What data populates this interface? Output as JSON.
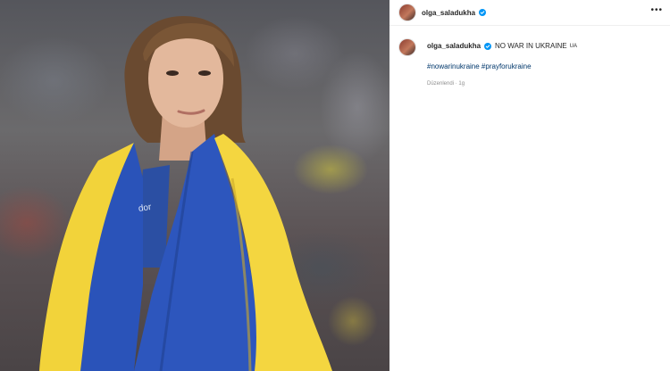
{
  "post": {
    "username": "olga_saladukha",
    "more_label": "•••",
    "caption": {
      "username": "olga_saladukha",
      "text": "NO WAR IN UKRAINE",
      "suffix": "UA",
      "hashtags": "#nowarinukraine #prayforukraine"
    },
    "meta": {
      "edited": "Düzenlendi",
      "separator": "·",
      "age": "1g"
    }
  },
  "photo": {
    "flag_colors": {
      "blue": "#2a53b9",
      "yellow": "#f2d33a"
    },
    "shirt_text": "dor"
  },
  "colors": {
    "verified": "#0095f6",
    "hashtag": "#00376b",
    "meta": "#8e8e8e",
    "text": "#262626"
  }
}
